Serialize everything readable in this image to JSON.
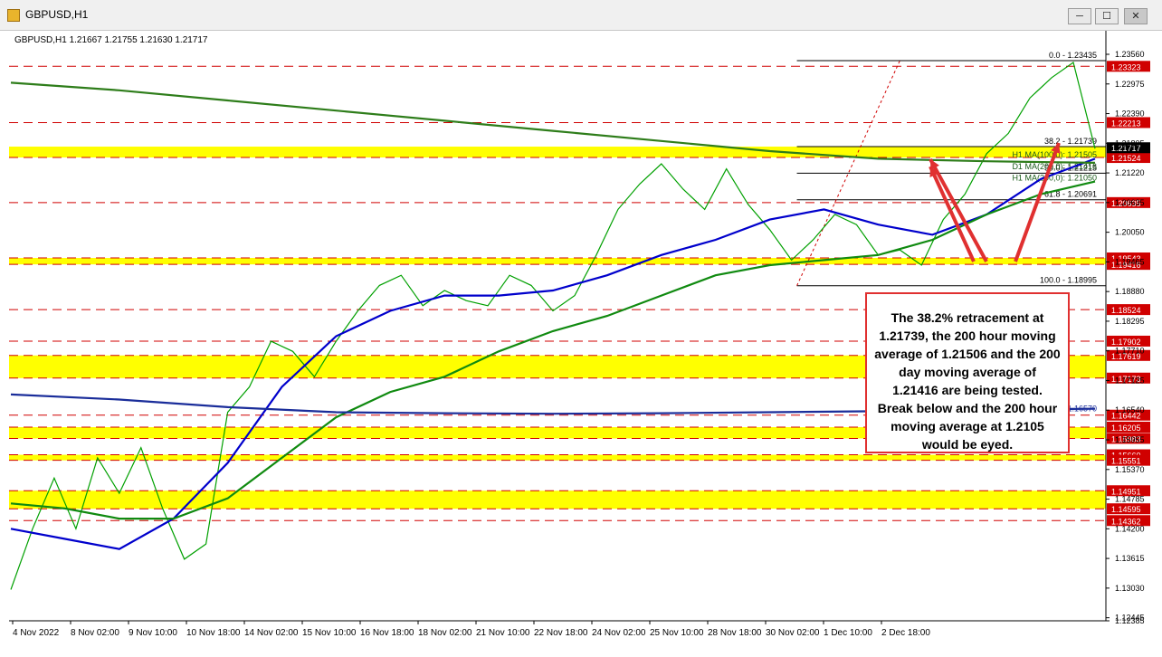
{
  "window": {
    "title": "GBPUSD,H1",
    "min_glyph": "─",
    "max_glyph": "☐",
    "close_glyph": "✕",
    "icon": "chart-app-icon"
  },
  "chart_header": "GBPUSD,H1  1.21667 1.21755 1.21630 1.21717",
  "callout_text": "The 38.2% retracement at 1.21739, the 200 hour moving average of 1.21506 and the 200 day moving average of 1.21416 are being tested. Break below and the 200 hour moving average at 1.2105 would be eyed.",
  "colors": {
    "price": "#00a000",
    "ma100": "#0000cc",
    "ma200": "#108a10",
    "day200": "#2e7d1a",
    "daily": "#1a2d9a",
    "zone": "#ffff00",
    "level": "#d00000",
    "callout": "#e03030"
  },
  "chart_data": {
    "type": "line",
    "symbol": "GBPUSD",
    "timeframe": "H1",
    "ohlc": [
      1.21667,
      1.21755,
      1.2163,
      1.21717
    ],
    "ylim": [
      1.12385,
      1.2356
    ],
    "x_labels": [
      "4 Nov 2022",
      "8 Nov 02:00",
      "9 Nov 10:00",
      "10 Nov 18:00",
      "14 Nov 02:00",
      "15 Nov 10:00",
      "16 Nov 18:00",
      "18 Nov 02:00",
      "21 Nov 10:00",
      "22 Nov 18:00",
      "24 Nov 02:00",
      "25 Nov 10:00",
      "28 Nov 18:00",
      "30 Nov 02:00",
      "1 Dec 10:00",
      "2 Dec 18:00"
    ],
    "y_ticks": [
      "1.23560",
      "1.22975",
      "1.22390",
      "1.21805",
      "1.21220",
      "1.20635",
      "1.20050",
      "1.19465",
      "1.18880",
      "1.18295",
      "1.17710",
      "1.17125",
      "1.16540",
      "1.15955",
      "1.15370",
      "1.14785",
      "1.14200",
      "1.13615",
      "1.13030",
      "1.12445",
      "1.12385"
    ],
    "current_price": "1.21717",
    "horizontal_levels": [
      {
        "value": 1.23323,
        "label": "1.23323"
      },
      {
        "value": 1.22213,
        "label": "1.22213"
      },
      {
        "value": 1.21524,
        "label": "1.21524"
      },
      {
        "value": 1.20635,
        "label": "1.20635"
      },
      {
        "value": 1.19543,
        "label": "1.19543"
      },
      {
        "value": 1.19416,
        "label": "1.19416"
      },
      {
        "value": 1.18524,
        "label": "1.18524"
      },
      {
        "value": 1.17902,
        "label": "1.17902"
      },
      {
        "value": 1.17619,
        "label": "1.17619"
      },
      {
        "value": 1.17173,
        "label": "1.17173"
      },
      {
        "value": 1.16442,
        "label": "1.16442"
      },
      {
        "value": 1.16205,
        "label": "1.16205"
      },
      {
        "value": 1.15983,
        "label": "1.15983"
      },
      {
        "value": 1.1566,
        "label": "1.15660"
      },
      {
        "value": 1.15551,
        "label": "1.15551"
      },
      {
        "value": 1.14951,
        "label": "1.14951"
      },
      {
        "value": 1.14595,
        "label": "1.14595"
      },
      {
        "value": 1.14362,
        "label": "1.14362"
      }
    ],
    "zones": [
      {
        "low": 1.21525,
        "high": 1.21739
      },
      {
        "low": 1.19416,
        "high": 1.19543
      },
      {
        "low": 1.17173,
        "high": 1.17619
      },
      {
        "low": 1.15983,
        "high": 1.16205
      },
      {
        "low": 1.15551,
        "high": 1.1566
      },
      {
        "low": 1.14595,
        "high": 1.14951
      }
    ],
    "fib_levels": [
      {
        "value": 1.23435,
        "label": "0.0 - 1.23435"
      },
      {
        "value": 1.21739,
        "label": "38.2 - 1.21739"
      },
      {
        "value": 1.21215,
        "label": "50.0 - 1.21215"
      },
      {
        "value": 1.20691,
        "label": "61.8 - 1.20691"
      },
      {
        "value": 1.18995,
        "label": "100.0 - 1.18995"
      }
    ],
    "ma_labels": [
      {
        "value": 1.21505,
        "label": "H1 MA(100,0): 1.21505"
      },
      {
        "value": 1.21416,
        "label": "D1 MA(200,0): 1.21416"
      },
      {
        "value": 1.2105,
        "label": "H1 MA(200,0): 1.21050"
      }
    ],
    "daily_ma_label": {
      "value": 1.1657,
      "label": "100.0 - 1.16570"
    },
    "series": [
      {
        "key": "price",
        "x": [
          0,
          2,
          4,
          6,
          8,
          10,
          12,
          14,
          16,
          18,
          20,
          22,
          24,
          26,
          28,
          30,
          32,
          34,
          36,
          38,
          40,
          42,
          44,
          46,
          48,
          50,
          52,
          54,
          56,
          58,
          60,
          62,
          64,
          66,
          68,
          70,
          72,
          74,
          76,
          78,
          80,
          82,
          84,
          86,
          88,
          90,
          92,
          94,
          96,
          98,
          100
        ],
        "values": [
          1.13,
          1.142,
          1.152,
          1.142,
          1.156,
          1.149,
          1.158,
          1.146,
          1.136,
          1.139,
          1.165,
          1.17,
          1.179,
          1.177,
          1.172,
          1.179,
          1.185,
          1.19,
          1.192,
          1.186,
          1.189,
          1.187,
          1.186,
          1.192,
          1.19,
          1.185,
          1.188,
          1.196,
          1.205,
          1.21,
          1.214,
          1.209,
          1.205,
          1.213,
          1.206,
          1.201,
          1.195,
          1.199,
          1.204,
          1.202,
          1.196,
          1.197,
          1.194,
          1.203,
          1.208,
          1.216,
          1.22,
          1.227,
          1.231,
          1.234,
          1.217
        ]
      },
      {
        "key": "ma100",
        "x": [
          0,
          5,
          10,
          15,
          20,
          25,
          30,
          35,
          40,
          45,
          50,
          55,
          60,
          65,
          70,
          75,
          80,
          85,
          90,
          95,
          100
        ],
        "values": [
          1.142,
          1.14,
          1.138,
          1.144,
          1.155,
          1.17,
          1.18,
          1.185,
          1.188,
          1.188,
          1.189,
          1.192,
          1.196,
          1.199,
          1.203,
          1.205,
          1.202,
          1.2,
          1.204,
          1.211,
          1.215
        ]
      },
      {
        "key": "ma200",
        "x": [
          0,
          5,
          10,
          15,
          20,
          25,
          30,
          35,
          40,
          45,
          50,
          55,
          60,
          65,
          70,
          75,
          80,
          85,
          90,
          95,
          100
        ],
        "values": [
          1.147,
          1.146,
          1.144,
          1.144,
          1.148,
          1.156,
          1.164,
          1.169,
          1.172,
          1.177,
          1.181,
          1.184,
          1.188,
          1.192,
          1.194,
          1.195,
          1.196,
          1.199,
          1.204,
          1.208,
          1.2105
        ]
      },
      {
        "key": "day200",
        "x": [
          0,
          10,
          20,
          30,
          40,
          50,
          60,
          70,
          80,
          90,
          100
        ],
        "values": [
          1.23,
          1.2285,
          1.2265,
          1.2245,
          1.2225,
          1.2205,
          1.2185,
          1.2165,
          1.215,
          1.2145,
          1.2142
        ]
      },
      {
        "key": "daily",
        "x": [
          0,
          10,
          20,
          30,
          40,
          50,
          60,
          70,
          80,
          90,
          100
        ],
        "values": [
          1.1685,
          1.1675,
          1.166,
          1.165,
          1.1648,
          1.1647,
          1.1648,
          1.165,
          1.1652,
          1.1655,
          1.1657
        ]
      }
    ]
  }
}
